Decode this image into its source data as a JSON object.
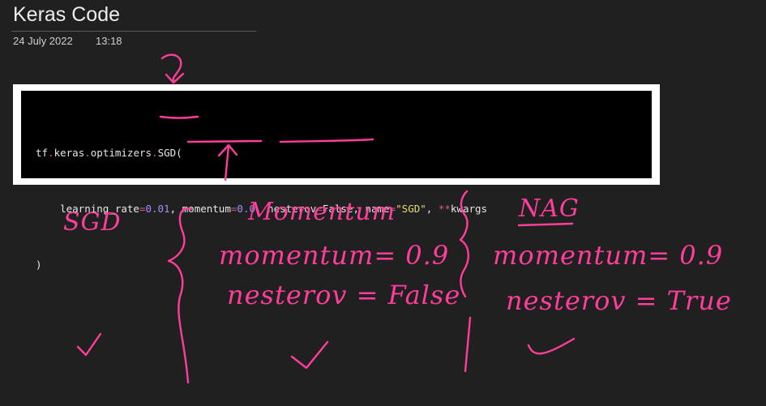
{
  "page": {
    "title": "Keras Code",
    "date": "24 July 2022",
    "time": "13:18"
  },
  "code": {
    "line1": [
      "tf",
      ".",
      "keras",
      ".",
      "optimizers",
      ".",
      "SGD("
    ],
    "line2": {
      "indent": "    ",
      "lr_name": "learning_rate",
      "lr_eq": "=",
      "lr_val": "0.01",
      "sep1": ", ",
      "mom_name": "momentum",
      "mom_eq": "=",
      "mom_val": "0.0",
      "sep2": ", ",
      "nes_name": "nesterov",
      "nes_eq": "=",
      "nes_val": "False",
      "sep3": ", ",
      "name_name": "name",
      "name_eq": "=",
      "name_val": "\"SGD\"",
      "sep4": ", ",
      "kw_op": "**",
      "kw_name": "kwargs"
    },
    "line3": ")"
  },
  "annotations": {
    "sgd_label": "SGD",
    "momentum_title": "Momentum",
    "momentum_param": "momentum= 0.9",
    "momentum_nesterov": "nesterov = False",
    "nag_title": "NAG",
    "nag_param": "momentum= 0.9",
    "nag_nesterov": "nesterov = True"
  },
  "colors": {
    "background": "#202020",
    "ink": "#ff3d9a",
    "code_bg": "#000000",
    "string": "#e6db74",
    "number": "#a78bfa",
    "operator": "#d45a8a"
  }
}
